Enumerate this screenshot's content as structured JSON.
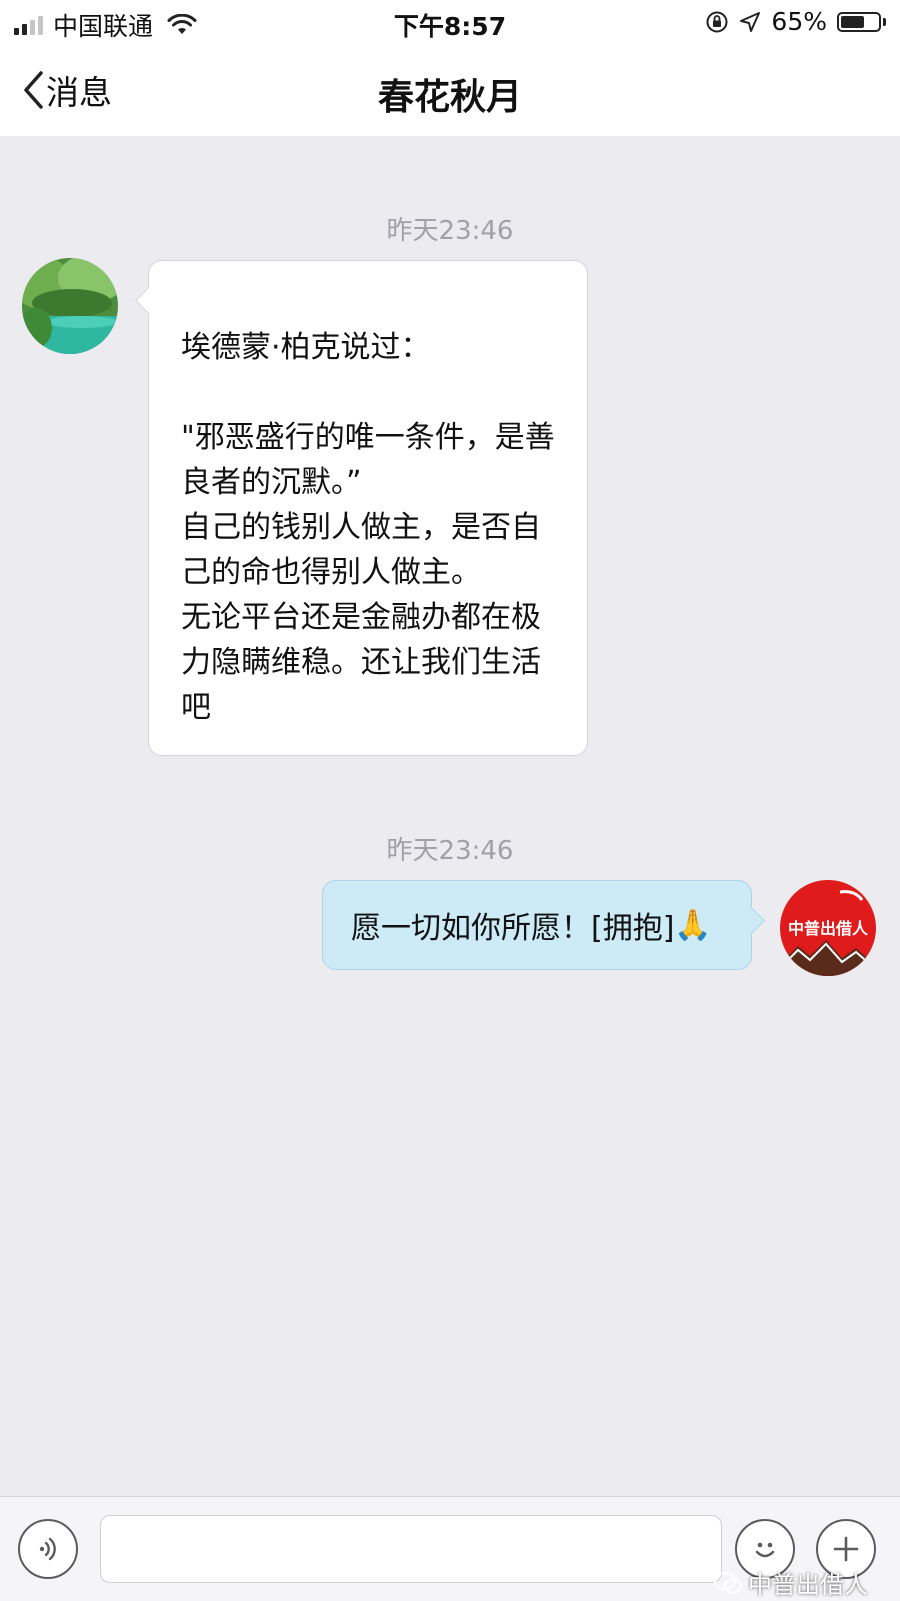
{
  "status_bar": {
    "carrier": "中国联通",
    "time": "下午8:57",
    "battery_percent": "65%",
    "battery_level": 0.65,
    "signal_bars_filled": 2,
    "icons": [
      "signal-icon",
      "wifi-icon",
      "orientation-lock-icon",
      "location-arrow-icon",
      "battery-icon"
    ]
  },
  "nav": {
    "back_label": "消息",
    "title": "春花秋月"
  },
  "messages": [
    {
      "timestamp": "昨天23:46",
      "sender": "other",
      "lines": [
        "埃德蒙·柏克说过：",
        "",
        "\"邪恶盛行的唯一条件，是善",
        "良者的沉默。”",
        "自己的钱别人做主，是否自",
        "己的命也得别人做主。",
        "无论平台还是金融办都在极",
        "力隐瞒维稳。还让我们生活",
        "吧"
      ]
    },
    {
      "timestamp": "昨天23:46",
      "sender": "me",
      "text": "愿一切如你所愿！[拥抱]",
      "emoji": "🙏",
      "avatar_text": "中普出借人"
    }
  ],
  "input_bar": {
    "icons": [
      "voice-icon",
      "emoji-icon",
      "plus-icon"
    ]
  },
  "watermark": {
    "text": "中普出借人"
  },
  "colors": {
    "background": "#ebebf0",
    "my_bubble": "#cdebf7",
    "other_bubble": "#ffffff",
    "timestamp": "#a0a0a6"
  }
}
